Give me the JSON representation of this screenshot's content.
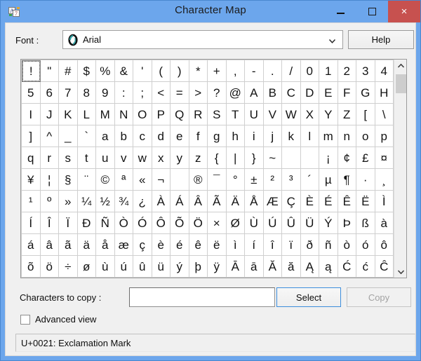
{
  "window": {
    "title": "Character Map",
    "app_icon": "character-map-icon",
    "frame_color": "#6ca6ec",
    "close_button_color": "#c7514f",
    "controls": {
      "minimize": "minimize-icon",
      "maximize": "maximize-icon",
      "close": "×"
    }
  },
  "font_row": {
    "label": "Font :",
    "selected_font": "Arial",
    "font_type_icon": "O",
    "dropdown_icon": "chevron-down-icon",
    "help_label": "Help"
  },
  "grid": {
    "columns": 20,
    "rows": 10,
    "focused_index": 0,
    "cells": [
      "!",
      "\"",
      "#",
      "$",
      "%",
      "&",
      "'",
      "(",
      ")",
      "*",
      "+",
      ",",
      "-",
      ".",
      "/",
      "0",
      "1",
      "2",
      "3",
      "4",
      "5",
      "6",
      "7",
      "8",
      "9",
      ":",
      ";",
      "<",
      "=",
      ">",
      "?",
      "@",
      "A",
      "B",
      "C",
      "D",
      "E",
      "F",
      "G",
      "H",
      "I",
      "J",
      "K",
      "L",
      "M",
      "N",
      "O",
      "P",
      "Q",
      "R",
      "S",
      "T",
      "U",
      "V",
      "W",
      "X",
      "Y",
      "Z",
      "[",
      "\\",
      "]",
      "^",
      "_",
      "`",
      "a",
      "b",
      "c",
      "d",
      "e",
      "f",
      "g",
      "h",
      "i",
      "j",
      "k",
      "l",
      "m",
      "n",
      "o",
      "p",
      "q",
      "r",
      "s",
      "t",
      "u",
      "v",
      "w",
      "x",
      "y",
      "z",
      "{",
      "|",
      "}",
      "~",
      "",
      "",
      "¡",
      "¢",
      "£",
      "¤",
      "¥",
      "¦",
      "§",
      "¨",
      "©",
      "ª",
      "«",
      "¬",
      "­",
      "®",
      "¯",
      "°",
      "±",
      "²",
      "³",
      "´",
      "µ",
      "¶",
      "·",
      "¸",
      "¹",
      "º",
      "»",
      "¼",
      "½",
      "¾",
      "¿",
      "À",
      "Á",
      "Â",
      "Ã",
      "Ä",
      "Å",
      "Æ",
      "Ç",
      "È",
      "É",
      "Ê",
      "Ë",
      "Ì",
      "Í",
      "Î",
      "Ï",
      "Ð",
      "Ñ",
      "Ò",
      "Ó",
      "Ô",
      "Õ",
      "Ö",
      "×",
      "Ø",
      "Ù",
      "Ú",
      "Û",
      "Ü",
      "Ý",
      "Þ",
      "ß",
      "à",
      "á",
      "â",
      "ã",
      "ä",
      "å",
      "æ",
      "ç",
      "è",
      "é",
      "ê",
      "ë",
      "ì",
      "í",
      "î",
      "ï",
      "ð",
      "ñ",
      "ò",
      "ó",
      "ô",
      "õ",
      "ö",
      "÷",
      "ø",
      "ù",
      "ú",
      "û",
      "ü",
      "ý",
      "þ",
      "ÿ",
      "Ā",
      "ā",
      "Ă",
      "ă",
      "Ą",
      "ą",
      "Ć",
      "ć",
      "Ĉ"
    ],
    "scrollbar": {
      "up_icon": "chevron-up-icon",
      "down_icon": "chevron-down-icon",
      "thumb_position": "top"
    }
  },
  "copy_row": {
    "label": "Characters to copy :",
    "input_value": "",
    "input_placeholder": "",
    "select_label": "Select",
    "copy_label": "Copy",
    "copy_disabled": true
  },
  "advanced": {
    "label": "Advanced view",
    "checked": false
  },
  "status": {
    "text": "U+0021: Exclamation Mark"
  }
}
